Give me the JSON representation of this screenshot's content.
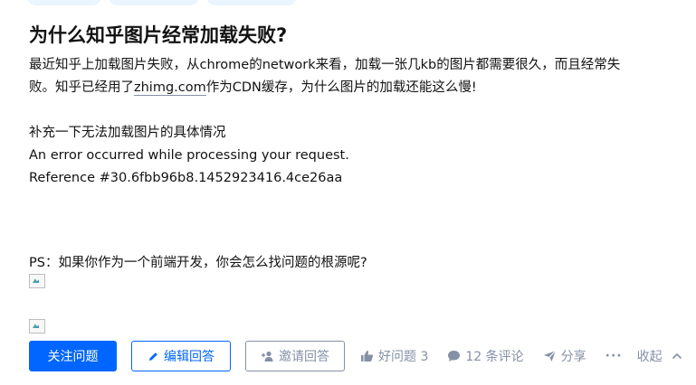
{
  "question": {
    "title": "为什么知乎图片经常加载失败?",
    "body": {
      "line1": "最近知乎上加载图片失败，从chrome的network来看，加载一张几kb的图片都需要很久，而且经常失",
      "line2_pre": "败。知乎已经用了",
      "line2_link": "zhimg.com",
      "line2_post": "作为CDN缓存，为什么图片的加载还能这么慢!",
      "supplement_heading": "补充一下无法加载图片的具体情况",
      "error_line": "An error occurred while processing your request.",
      "reference_line": "Reference #30.6fbb96b8.1452923416.4ce26aa"
    },
    "ps": "PS：如果你作为一个前端开发，你会怎么找问题的根源呢?"
  },
  "actions": {
    "follow_label": "关注问题",
    "edit_label": "编辑回答",
    "invite_label": "邀请回答",
    "helpful_label": "好问题 3",
    "comments_label": "12 条评论",
    "share_label": "分享",
    "more_label": "···",
    "collapse_label": "收起"
  },
  "colors": {
    "accent": "#0066ff",
    "muted": "#8590a6",
    "text": "#121212"
  },
  "icons": {
    "edit": "pencil-icon",
    "invite": "add-user-icon",
    "helpful": "thumbs-up-icon",
    "comments": "comment-bubble-icon",
    "share": "paper-plane-icon",
    "collapse": "chevron-up-icon",
    "image": "broken-image-icon"
  }
}
